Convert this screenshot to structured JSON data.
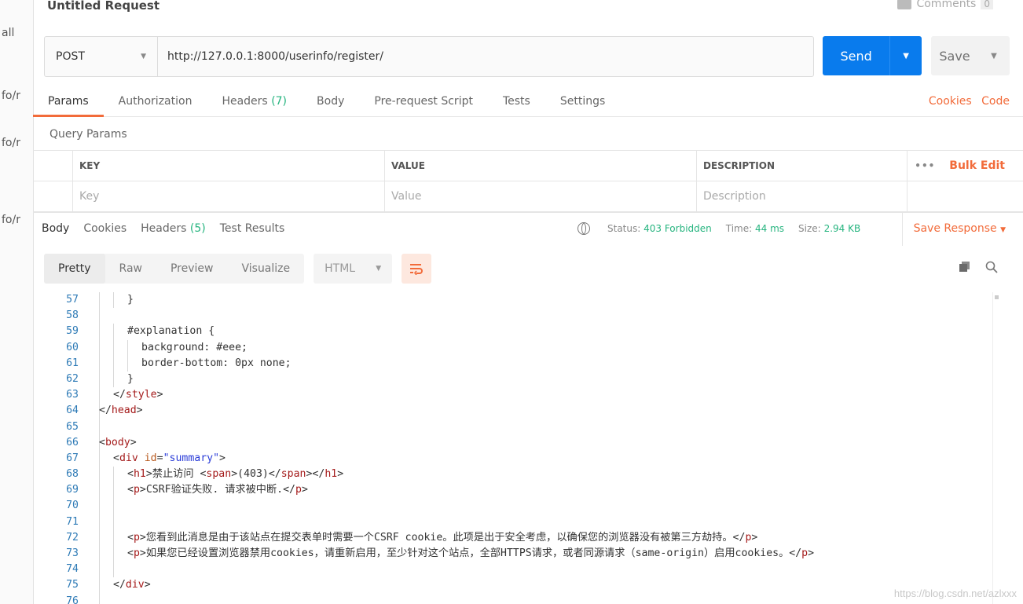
{
  "sidebar": {
    "fragments": [
      "all",
      "fo/r",
      "fo/r",
      "fo/r"
    ]
  },
  "request": {
    "title": "Untitled Request",
    "comments_label": "Comments",
    "comments_count": "0",
    "method": "POST",
    "url": "http://127.0.0.1:8000/userinfo/register/",
    "send_label": "Send",
    "save_label": "Save"
  },
  "request_tabs": {
    "params": "Params",
    "authorization": "Authorization",
    "headers": "Headers",
    "headers_count": "(7)",
    "body": "Body",
    "prerequest": "Pre-request Script",
    "tests": "Tests",
    "settings": "Settings",
    "cookies": "Cookies",
    "code": "Code"
  },
  "query_params": {
    "title": "Query Params",
    "columns": [
      "KEY",
      "VALUE",
      "DESCRIPTION"
    ],
    "placeholders": [
      "Key",
      "Value",
      "Description"
    ],
    "more": "•••",
    "bulk_edit": "Bulk Edit"
  },
  "response": {
    "tabs": {
      "body": "Body",
      "cookies": "Cookies",
      "headers": "Headers",
      "headers_count": "(5)",
      "test_results": "Test Results"
    },
    "status_label": "Status:",
    "status_value": "403 Forbidden",
    "time_label": "Time:",
    "time_value": "44 ms",
    "size_label": "Size:",
    "size_value": "2.94 KB",
    "save_response": "Save Response",
    "view_modes": [
      "Pretty",
      "Raw",
      "Preview",
      "Visualize"
    ],
    "format": "HTML"
  },
  "editor": {
    "lines": [
      {
        "n": "57",
        "indent": 2,
        "parts": [
          [
            "plain",
            "}"
          ]
        ]
      },
      {
        "n": "58",
        "indent": 0,
        "parts": []
      },
      {
        "n": "59",
        "indent": 2,
        "parts": [
          [
            "plain",
            "#explanation {"
          ]
        ]
      },
      {
        "n": "60",
        "indent": 3,
        "parts": [
          [
            "plain",
            "background: #eee;"
          ]
        ]
      },
      {
        "n": "61",
        "indent": 3,
        "parts": [
          [
            "plain",
            "border-bottom: 0px none;"
          ]
        ]
      },
      {
        "n": "62",
        "indent": 2,
        "parts": [
          [
            "plain",
            "}"
          ]
        ]
      },
      {
        "n": "63",
        "indent": 1,
        "parts": [
          [
            "plain",
            "</"
          ],
          [
            "tag",
            "style"
          ],
          [
            "plain",
            ">"
          ]
        ]
      },
      {
        "n": "64",
        "indent": 0,
        "parts": [
          [
            "plain",
            "</"
          ],
          [
            "tag",
            "head"
          ],
          [
            "plain",
            ">"
          ]
        ]
      },
      {
        "n": "65",
        "indent": 0,
        "parts": []
      },
      {
        "n": "66",
        "indent": 0,
        "parts": [
          [
            "plain",
            "<"
          ],
          [
            "tag",
            "body"
          ],
          [
            "plain",
            ">"
          ]
        ]
      },
      {
        "n": "67",
        "indent": 1,
        "parts": [
          [
            "plain",
            "<"
          ],
          [
            "tag",
            "div"
          ],
          [
            "plain",
            " "
          ],
          [
            "attr",
            "id"
          ],
          [
            "plain",
            "="
          ],
          [
            "str",
            "\"summary\""
          ],
          [
            "plain",
            ">"
          ]
        ]
      },
      {
        "n": "68",
        "indent": 2,
        "parts": [
          [
            "plain",
            "<"
          ],
          [
            "tag",
            "h1"
          ],
          [
            "plain",
            ">禁止访问 <"
          ],
          [
            "tag",
            "span"
          ],
          [
            "plain",
            ">(403)</"
          ],
          [
            "tag",
            "span"
          ],
          [
            "plain",
            "></"
          ],
          [
            "tag",
            "h1"
          ],
          [
            "plain",
            ">"
          ]
        ]
      },
      {
        "n": "69",
        "indent": 2,
        "parts": [
          [
            "plain",
            "<"
          ],
          [
            "tag",
            "p"
          ],
          [
            "plain",
            ">CSRF验证失败. 请求被中断.</"
          ],
          [
            "tag",
            "p"
          ],
          [
            "plain",
            ">"
          ]
        ]
      },
      {
        "n": "70",
        "indent": 0,
        "parts": []
      },
      {
        "n": "71",
        "indent": 0,
        "parts": []
      },
      {
        "n": "72",
        "indent": 2,
        "parts": [
          [
            "plain",
            "<"
          ],
          [
            "tag",
            "p"
          ],
          [
            "plain",
            ">您看到此消息是由于该站点在提交表单时需要一个CSRF cookie。此项是出于安全考虑，以确保您的浏览器没有被第三方劫持。</"
          ],
          [
            "tag",
            "p"
          ],
          [
            "plain",
            ">"
          ]
        ]
      },
      {
        "n": "73",
        "indent": 2,
        "parts": [
          [
            "plain",
            "<"
          ],
          [
            "tag",
            "p"
          ],
          [
            "plain",
            ">如果您已经设置浏览器禁用cookies，请重新启用，至少针对这个站点，全部HTTPS请求，或者同源请求（same-origin）启用cookies。</"
          ],
          [
            "tag",
            "p"
          ],
          [
            "plain",
            ">"
          ]
        ]
      },
      {
        "n": "74",
        "indent": 0,
        "parts": []
      },
      {
        "n": "75",
        "indent": 1,
        "parts": [
          [
            "plain",
            "</"
          ],
          [
            "tag",
            "div"
          ],
          [
            "plain",
            ">"
          ]
        ]
      },
      {
        "n": "76",
        "indent": 0,
        "parts": []
      }
    ]
  },
  "watermark": "https://blog.csdn.net/azlxxx"
}
